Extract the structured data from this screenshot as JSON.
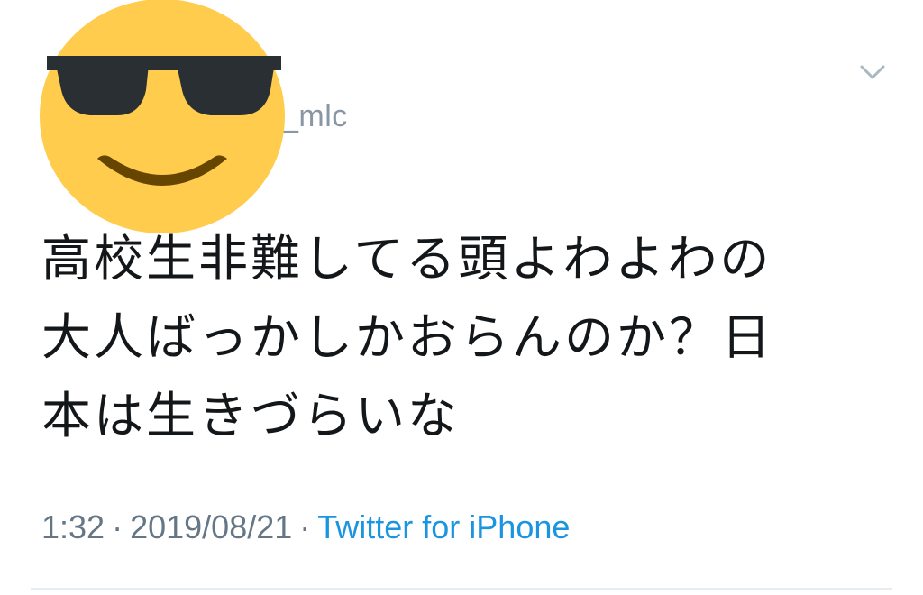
{
  "author": {
    "avatar_icon": "smiling-face-with-sunglasses-icon",
    "handle_fragment": "_mlc"
  },
  "menu": {
    "icon": "chevron-down-icon"
  },
  "tweet": {
    "lines": [
      "高校生非難してる頭よわよわの",
      "大人ばっかしかおらんのか？日",
      "本は生きづらいな"
    ]
  },
  "meta": {
    "time": "1:32",
    "separator": "·",
    "date": "2019/08/21",
    "source": "Twitter for iPhone"
  },
  "colors": {
    "text": "#14171a",
    "muted": "#657786",
    "handle": "#8a96a3",
    "link": "#1b95e0",
    "emoji_face": "#FFCC4D",
    "emoji_glasses": "#292F33",
    "emoji_mouth": "#664500"
  }
}
